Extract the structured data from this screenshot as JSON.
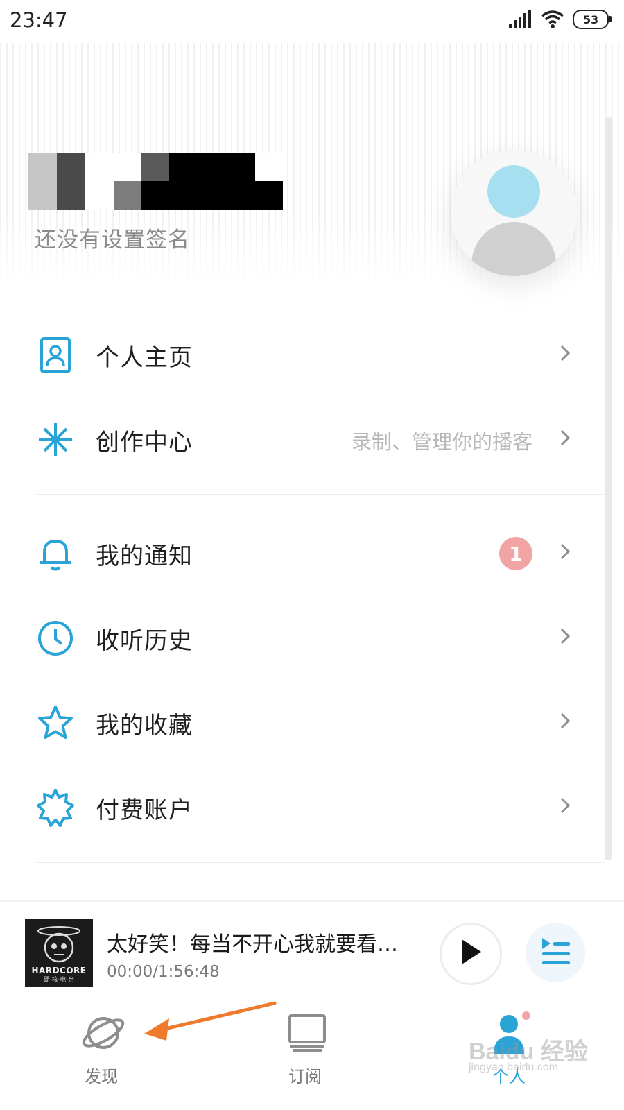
{
  "status_bar": {
    "time": "23:47",
    "battery": "53"
  },
  "profile": {
    "signature": "还没有设置签名"
  },
  "menu": {
    "profile_page": "个人主页",
    "creator_center": "创作中心",
    "creator_center_sub": "录制、管理你的播客",
    "notifications": "我的通知",
    "notifications_badge": "1",
    "history": "收听历史",
    "favorites": "我的收藏",
    "paid_account": "付费账户"
  },
  "player": {
    "title": "太好笑！每当不开心我就要看…",
    "time": "00:00/1:56:48",
    "cover_text": "HARDCORE",
    "cover_sub": "硬·核·电·台"
  },
  "nav": {
    "discover": "发现",
    "subscribe": "订阅",
    "me": "个人"
  },
  "watermark": {
    "main": "Baidu 经验",
    "sub": "jingyan.baidu.com"
  },
  "colors": {
    "accent": "#2aa3d6",
    "badge": "#f2a3a3",
    "annotation_arrow": "#f07a2c"
  }
}
